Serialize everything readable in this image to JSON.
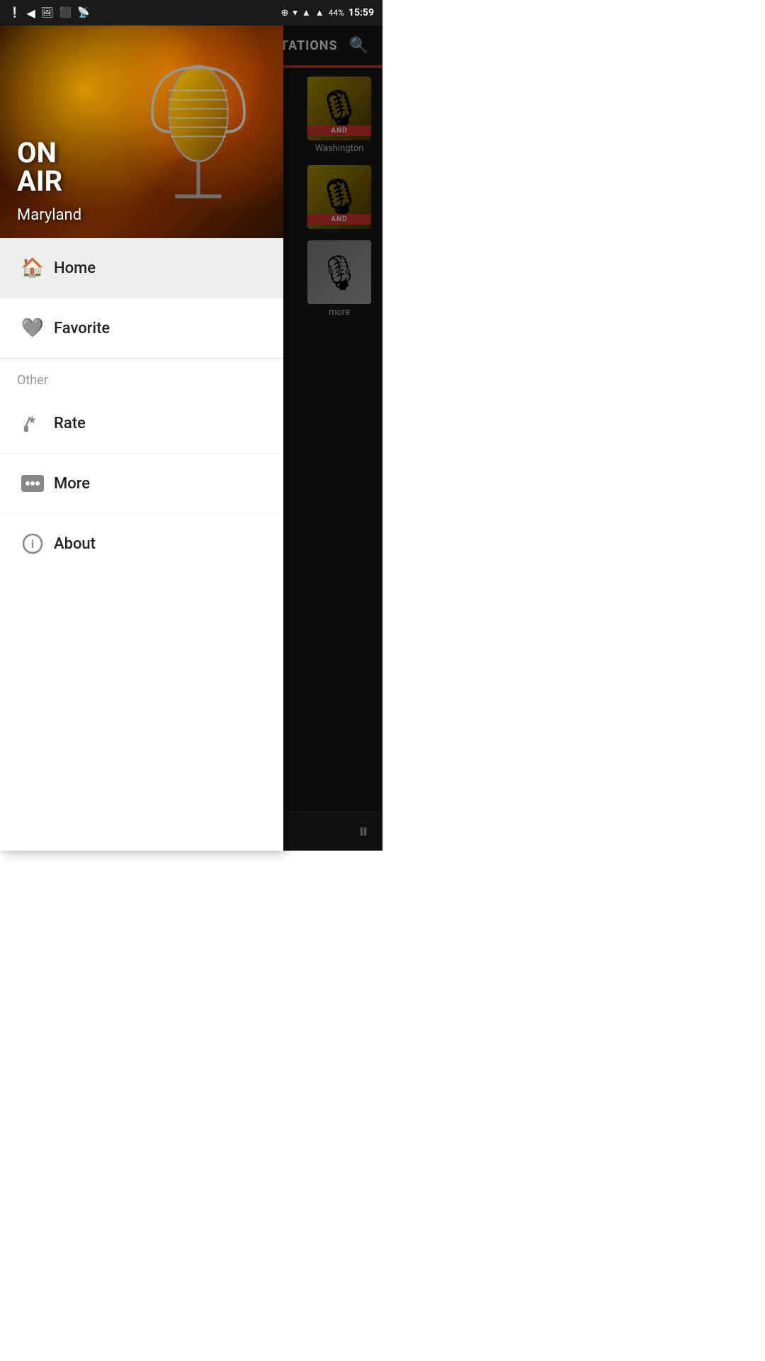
{
  "statusBar": {
    "time": "15:59",
    "battery": "44%"
  },
  "mainContent": {
    "header": {
      "title": "STATIONS",
      "searchLabel": "search"
    },
    "stations": [
      {
        "name": "Washington",
        "badge": "AND"
      },
      {
        "name": "",
        "badge": "AND"
      },
      {
        "name": "more",
        "badge": ""
      }
    ]
  },
  "drawer": {
    "headerImage": {
      "onAirText": "ON\nAIR",
      "locationText": "Maryland"
    },
    "menuItems": [
      {
        "id": "home",
        "label": "Home",
        "icon": "home"
      },
      {
        "id": "favorite",
        "label": "Favorite",
        "icon": "heart"
      }
    ],
    "otherSection": {
      "label": "Other",
      "items": [
        {
          "id": "rate",
          "label": "Rate",
          "icon": "rate"
        },
        {
          "id": "more",
          "label": "More",
          "icon": "more"
        },
        {
          "id": "about",
          "label": "About",
          "icon": "info"
        }
      ]
    }
  },
  "player": {
    "pauseLabel": "⏸"
  }
}
